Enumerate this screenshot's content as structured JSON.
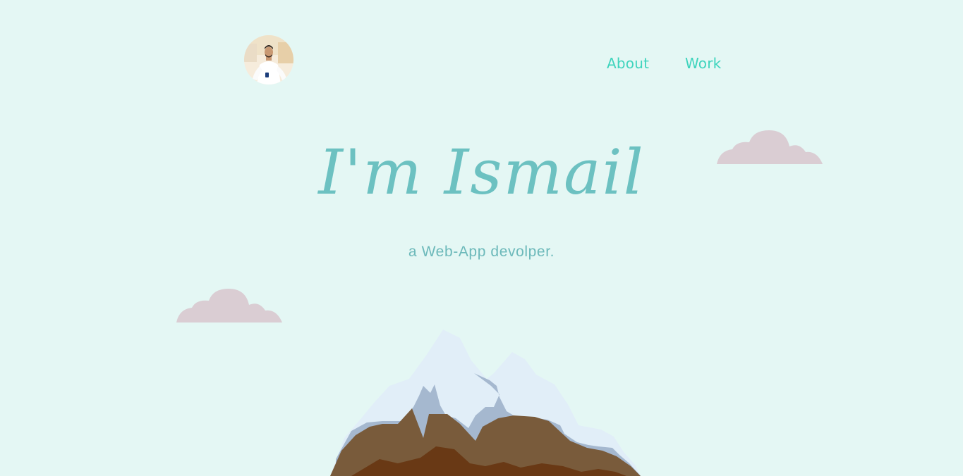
{
  "header": {
    "avatar_alt": "Profile photo",
    "nav": [
      {
        "label": "About"
      },
      {
        "label": "Work"
      }
    ]
  },
  "hero": {
    "title": "I'm Ismail",
    "subtitle": "a Web-App devolper."
  },
  "colors": {
    "background": "#e4f7f4",
    "accent_nav": "#3ed4bd",
    "title": "#6cc1c1",
    "subtitle": "#6cb9ba",
    "cloud": "#dacdd3",
    "snow": "#e1eef8",
    "snow_shadow": "#a5b8cf",
    "rock": "#795b3b",
    "rock_dark": "#693915"
  },
  "icons": {
    "clouds": "cloud-icon",
    "mountain": "mountain-illustration"
  }
}
